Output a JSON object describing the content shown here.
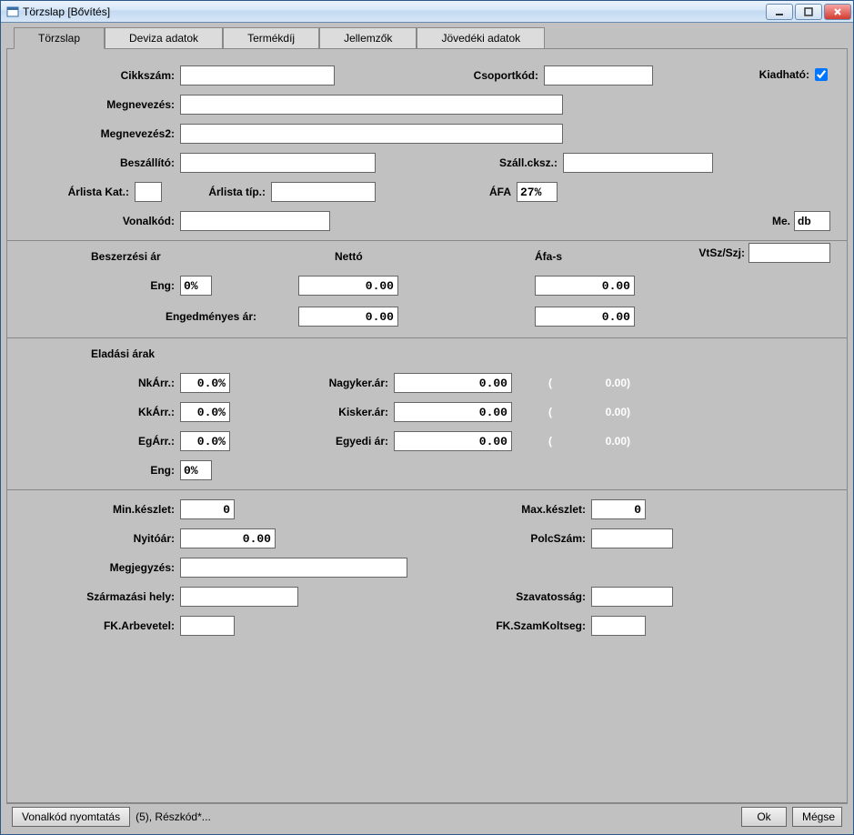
{
  "window": {
    "title": "Törzslap [Bővítés]"
  },
  "tabs": [
    "Törzslap",
    "Deviza adatok",
    "Termékdíj",
    "Jellemzők",
    "Jövedéki adatok"
  ],
  "labels": {
    "cikkszam": "Cikkszám:",
    "csoportkod": "Csoportkód:",
    "kiadhato": "Kiadható:",
    "megnevezes": "Megnevezés:",
    "megnevezes2": "Megnevezés2:",
    "beszallito": "Beszállító:",
    "szallcksz": "Száll.cksz.:",
    "arlistakat": "Árlista Kat.:",
    "arlistatip": "Árlista típ.:",
    "afa": "ÁFA",
    "me": "Me.",
    "vonalkod": "Vonalkód:",
    "vtsz": "VtSz/Szj:",
    "beszerzesi": "Beszerzési ár",
    "netto": "Nettó",
    "afas": "Áfa-s",
    "eng": "Eng:",
    "engedmenyes": "Engedményes ár:",
    "eladasi": "Eladási árak",
    "nkarr": "NkÁrr.:",
    "nagykerar": "Nagyker.ár:",
    "kkarr": "KkÁrr.:",
    "kiskerar": "Kisker.ár:",
    "egarr": "EgÁrr.:",
    "egyediar": "Egyedi ár:",
    "minkeszlet": "Min.készlet:",
    "maxkeszlet": "Max.készlet:",
    "nyitoar": "Nyitóár:",
    "polcszam": "PolcSzám:",
    "megjegyzes": "Megjegyzés:",
    "szarmazasihely": "Származási hely:",
    "szavatossag": "Szavatosság:",
    "fkarbevetel": "FK.Arbevetel:",
    "fkszamkoltseg": "FK.SzamKoltseg:"
  },
  "values": {
    "cikkszam": "",
    "csoportkod": "",
    "kiadhato": true,
    "megnevezes": "",
    "megnevezes2": "",
    "beszallito": "",
    "szallcksz": "",
    "arlistakat": "",
    "arlistatip": "",
    "afa": "27%",
    "me": "db",
    "vonalkod": "",
    "vtsz": "",
    "eng": "0%",
    "netto_engedmeny": "0.00",
    "afas_engedmeny": "0.00",
    "netto_engedmenyes": "0.00",
    "afas_engedmenyes": "0.00",
    "nkarr": "0.0%",
    "kkarr": "0.0%",
    "egarr": "0.0%",
    "eng2": "0%",
    "nagykerar": "0.00",
    "kiskerar": "0.00",
    "egyediar": "0.00",
    "paren_nagy": "0.00)",
    "paren_kis": "0.00)",
    "paren_egy": "0.00)",
    "minkeszlet": "0",
    "maxkeszlet": "0",
    "nyitoar": "0.00",
    "polcszam": "",
    "megjegyzes": "",
    "szarmazasihely": "",
    "szavatossag": "",
    "fkarbevetel": "",
    "fkszamkoltseg": ""
  },
  "footer": {
    "vonalkod_btn": "Vonalkód nyomtatás",
    "status": "(5), Részkód*...",
    "ok": "Ok",
    "megse": "Mégse"
  }
}
